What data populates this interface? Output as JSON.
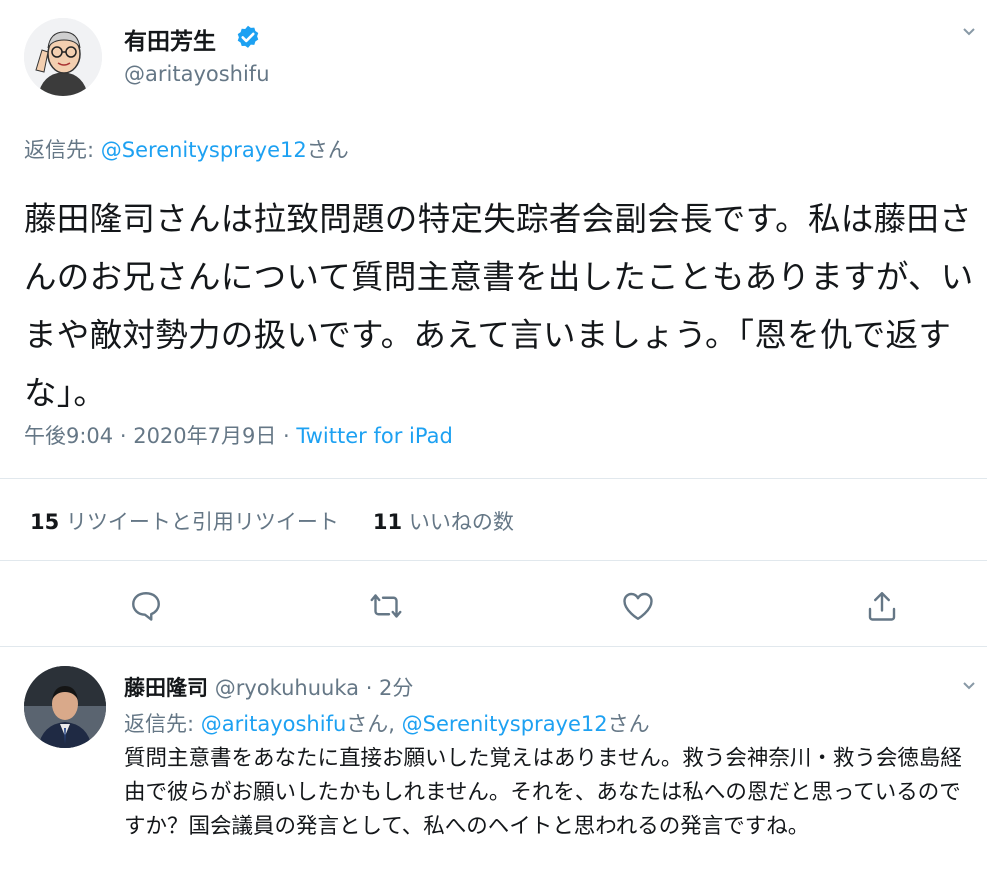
{
  "tweet": {
    "author_name": "有田芳生",
    "author_handle": "@aritayoshifu",
    "reply_prefix": "返信先: ",
    "reply_to": "@Serenityspraye12",
    "reply_suffix": "さん",
    "text": "藤田隆司さんは拉致問題の特定失踪者会副会長です。私は藤田さんのお兄さんについて質問主意書を出したこともありますが、いまや敵対勢力の扱いです。あえて言いましょう。「恩を仇で返すな」。",
    "time": "午後9:04",
    "separator": " · ",
    "date": "2020年7月9日",
    "source": "Twitter for iPad",
    "retweet_count": "15",
    "retweet_label": "リツイートと引用リツイート",
    "like_count": "11",
    "like_label": "いいねの数"
  },
  "reply": {
    "author_name": "藤田隆司",
    "author_handle": "@ryokuhuuka",
    "separator": " · ",
    "time_ago": "2分",
    "reply_prefix": "返信先: ",
    "reply_to_1": "@aritayoshifu",
    "reply_mid": "さん, ",
    "reply_to_2": "@Serenityspraye12",
    "reply_suffix": "さん",
    "text": "質問主意書をあなたに直接お願いした覚えはありません。救う会神奈川・救う会徳島経由で彼らがお願いしたかもしれません。それを、あなたは私への恩だと思っているのですか？国会議員の発言として、私へのヘイトと思われるの発言ですね。"
  },
  "icons": [
    "verified-icon",
    "chevron-down-icon",
    "reply-icon",
    "retweet-icon",
    "like-icon",
    "share-icon"
  ],
  "colors": {
    "accent": "#1da1f2",
    "muted": "#657786",
    "text": "#14171a",
    "divider": "#e1e8ed"
  }
}
